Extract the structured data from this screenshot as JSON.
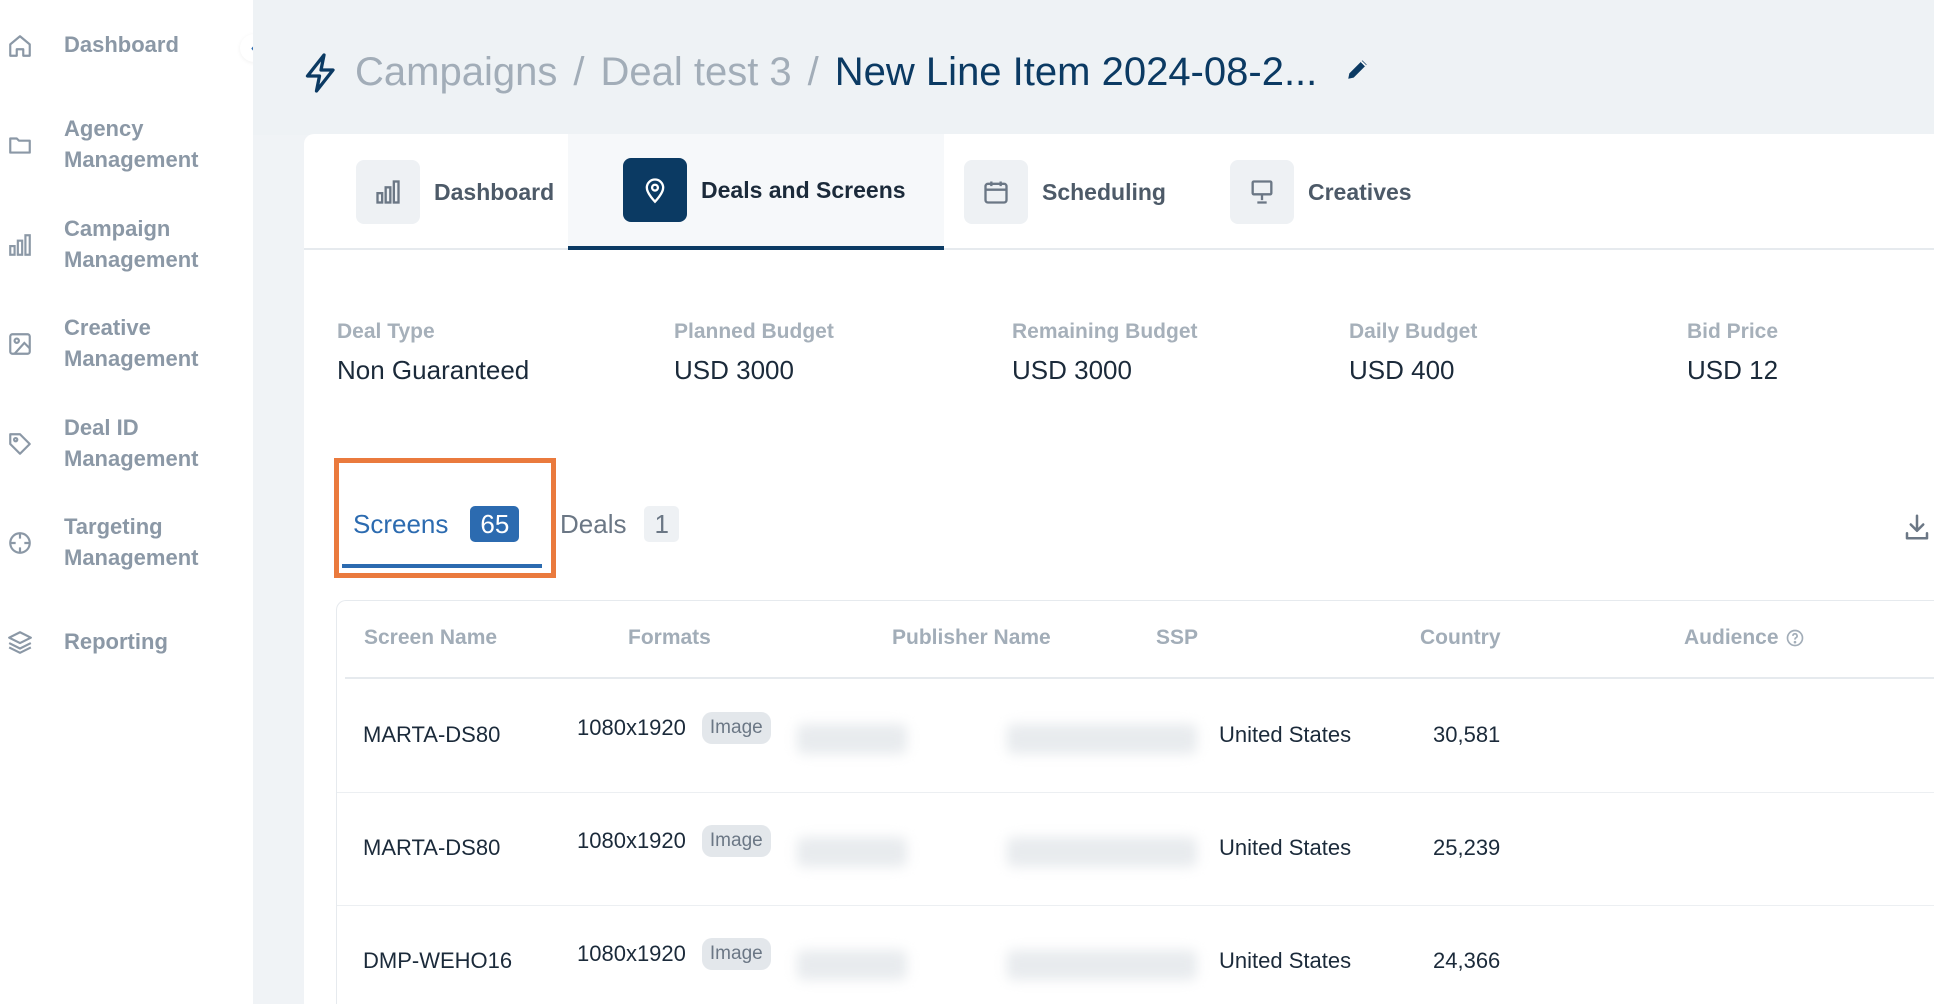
{
  "sidebar": {
    "items": [
      {
        "label_line1": "Dashboard",
        "label_line2": "",
        "icon": "home-icon"
      },
      {
        "label_line1": "Agency",
        "label_line2": "Management",
        "icon": "folder-icon"
      },
      {
        "label_line1": "Campaign",
        "label_line2": "Management",
        "icon": "bar-chart-icon"
      },
      {
        "label_line1": "Creative",
        "label_line2": "Management",
        "icon": "image-icon"
      },
      {
        "label_line1": "Deal ID",
        "label_line2": "Management",
        "icon": "tag-icon"
      },
      {
        "label_line1": "Targeting",
        "label_line2": "Management",
        "icon": "crosshair-icon"
      },
      {
        "label_line1": "Reporting",
        "label_line2": "",
        "icon": "layers-icon"
      }
    ],
    "collapse_glyph": "‹"
  },
  "header": {
    "crumbs": [
      "Campaigns",
      "Deal test 3"
    ],
    "separator": "/",
    "current": "New Line Item 2024-08-2..."
  },
  "tabs": [
    {
      "label": "Dashboard",
      "icon": "bar-chart-icon"
    },
    {
      "label": "Deals and Screens",
      "icon": "map-pin-icon"
    },
    {
      "label": "Scheduling",
      "icon": "calendar-icon"
    },
    {
      "label": "Creatives",
      "icon": "monitor-icon"
    }
  ],
  "summary": [
    {
      "label": "Deal Type",
      "value": "Non Guaranteed"
    },
    {
      "label": "Planned Budget",
      "value": "USD 3000"
    },
    {
      "label": "Remaining Budget",
      "value": "USD 3000"
    },
    {
      "label": "Daily Budget",
      "value": "USD 400"
    },
    {
      "label": "Bid Price",
      "value": "USD 12"
    }
  ],
  "subtabs": {
    "screens": {
      "label": "Screens",
      "count": "65"
    },
    "deals": {
      "label": "Deals",
      "count": "1"
    }
  },
  "table": {
    "headers": [
      "Screen Name",
      "Formats",
      "Publisher Name",
      "SSP",
      "Country",
      "Audience"
    ],
    "rows": [
      {
        "screen_name": "MARTA-DS80",
        "format": "1080x1920",
        "format_type": "Image",
        "country": "United States",
        "audience": "30,581"
      },
      {
        "screen_name": "MARTA-DS80",
        "format": "1080x1920",
        "format_type": "Image",
        "country": "United States",
        "audience": "25,239"
      },
      {
        "screen_name": "DMP-WEHO16",
        "format": "1080x1920",
        "format_type": "Image",
        "country": "United States",
        "audience": "24,366"
      }
    ]
  },
  "colors": {
    "primary": "#0b3a63",
    "accent": "#2c6bb0",
    "highlight": "#ea7a3d"
  }
}
